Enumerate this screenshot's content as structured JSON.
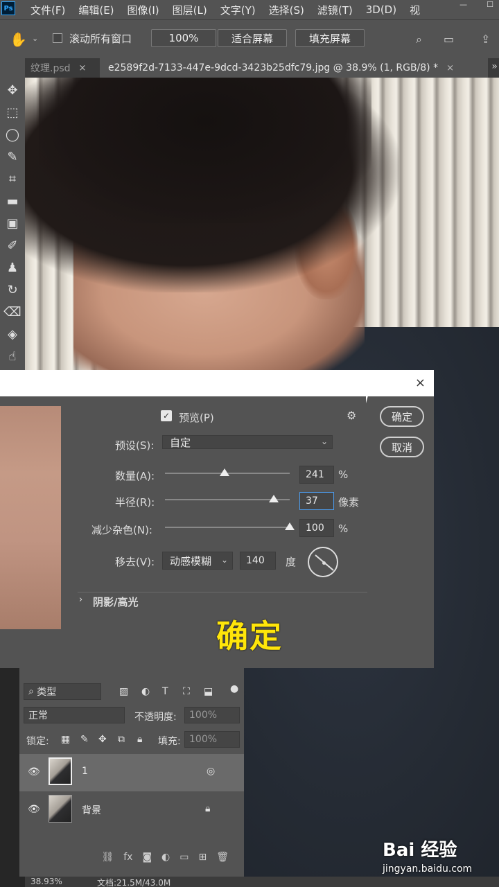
{
  "app": {
    "logo": "Ps"
  },
  "menu": [
    "文件(F)",
    "编辑(E)",
    "图像(I)",
    "图层(L)",
    "文字(Y)",
    "选择(S)",
    "滤镜(T)",
    "3D(D)",
    "视"
  ],
  "options": {
    "scroll_all_label": "滚动所有窗口",
    "zoom_button": "100%",
    "fit_screen_button": "适合屏幕",
    "fill_screen_button": "填充屏幕"
  },
  "tabs": [
    {
      "label": "纹理.psd",
      "close": "×"
    },
    {
      "label": "e2589f2d-7133-447e-9dcd-3423b25dfc79.jpg @ 38.9% (1, RGB/8) *",
      "close": "×"
    }
  ],
  "tabs_more": "»",
  "dialog": {
    "close": "×",
    "preview_label": "预览(P)",
    "preset_label": "预设(S):",
    "preset_value": "自定",
    "amount_label": "数量(A):",
    "amount_value": "241",
    "amount_unit": "%",
    "amount_fraction": 0.48,
    "radius_label": "半径(R):",
    "radius_value": "37",
    "radius_unit": "像素",
    "radius_fraction": 0.87,
    "noise_label": "减少杂色(N):",
    "noise_value": "100",
    "noise_unit": "%",
    "noise_fraction": 1.0,
    "remove_label": "移去(V):",
    "remove_value": "动感模糊",
    "angle_value": "140",
    "angle_unit": "度",
    "shadows_label": "阴影/高光",
    "ok_button": "确定",
    "cancel_button": "取消"
  },
  "caption": "确定",
  "layers": {
    "filter_kind": "类型",
    "blend_mode": "正常",
    "opacity_label": "不透明度:",
    "opacity_value": "100%",
    "lock_label": "锁定:",
    "fill_label": "填充:",
    "fill_value": "100%",
    "items": [
      {
        "name": "1",
        "selected": true
      },
      {
        "name": "背景",
        "selected": false
      }
    ]
  },
  "status": {
    "zoom": "38.93%",
    "doc": "文档:21.5M/43.0M"
  },
  "watermark": {
    "brand": "Bai 经验",
    "url": "jingyan.baidu.com"
  }
}
